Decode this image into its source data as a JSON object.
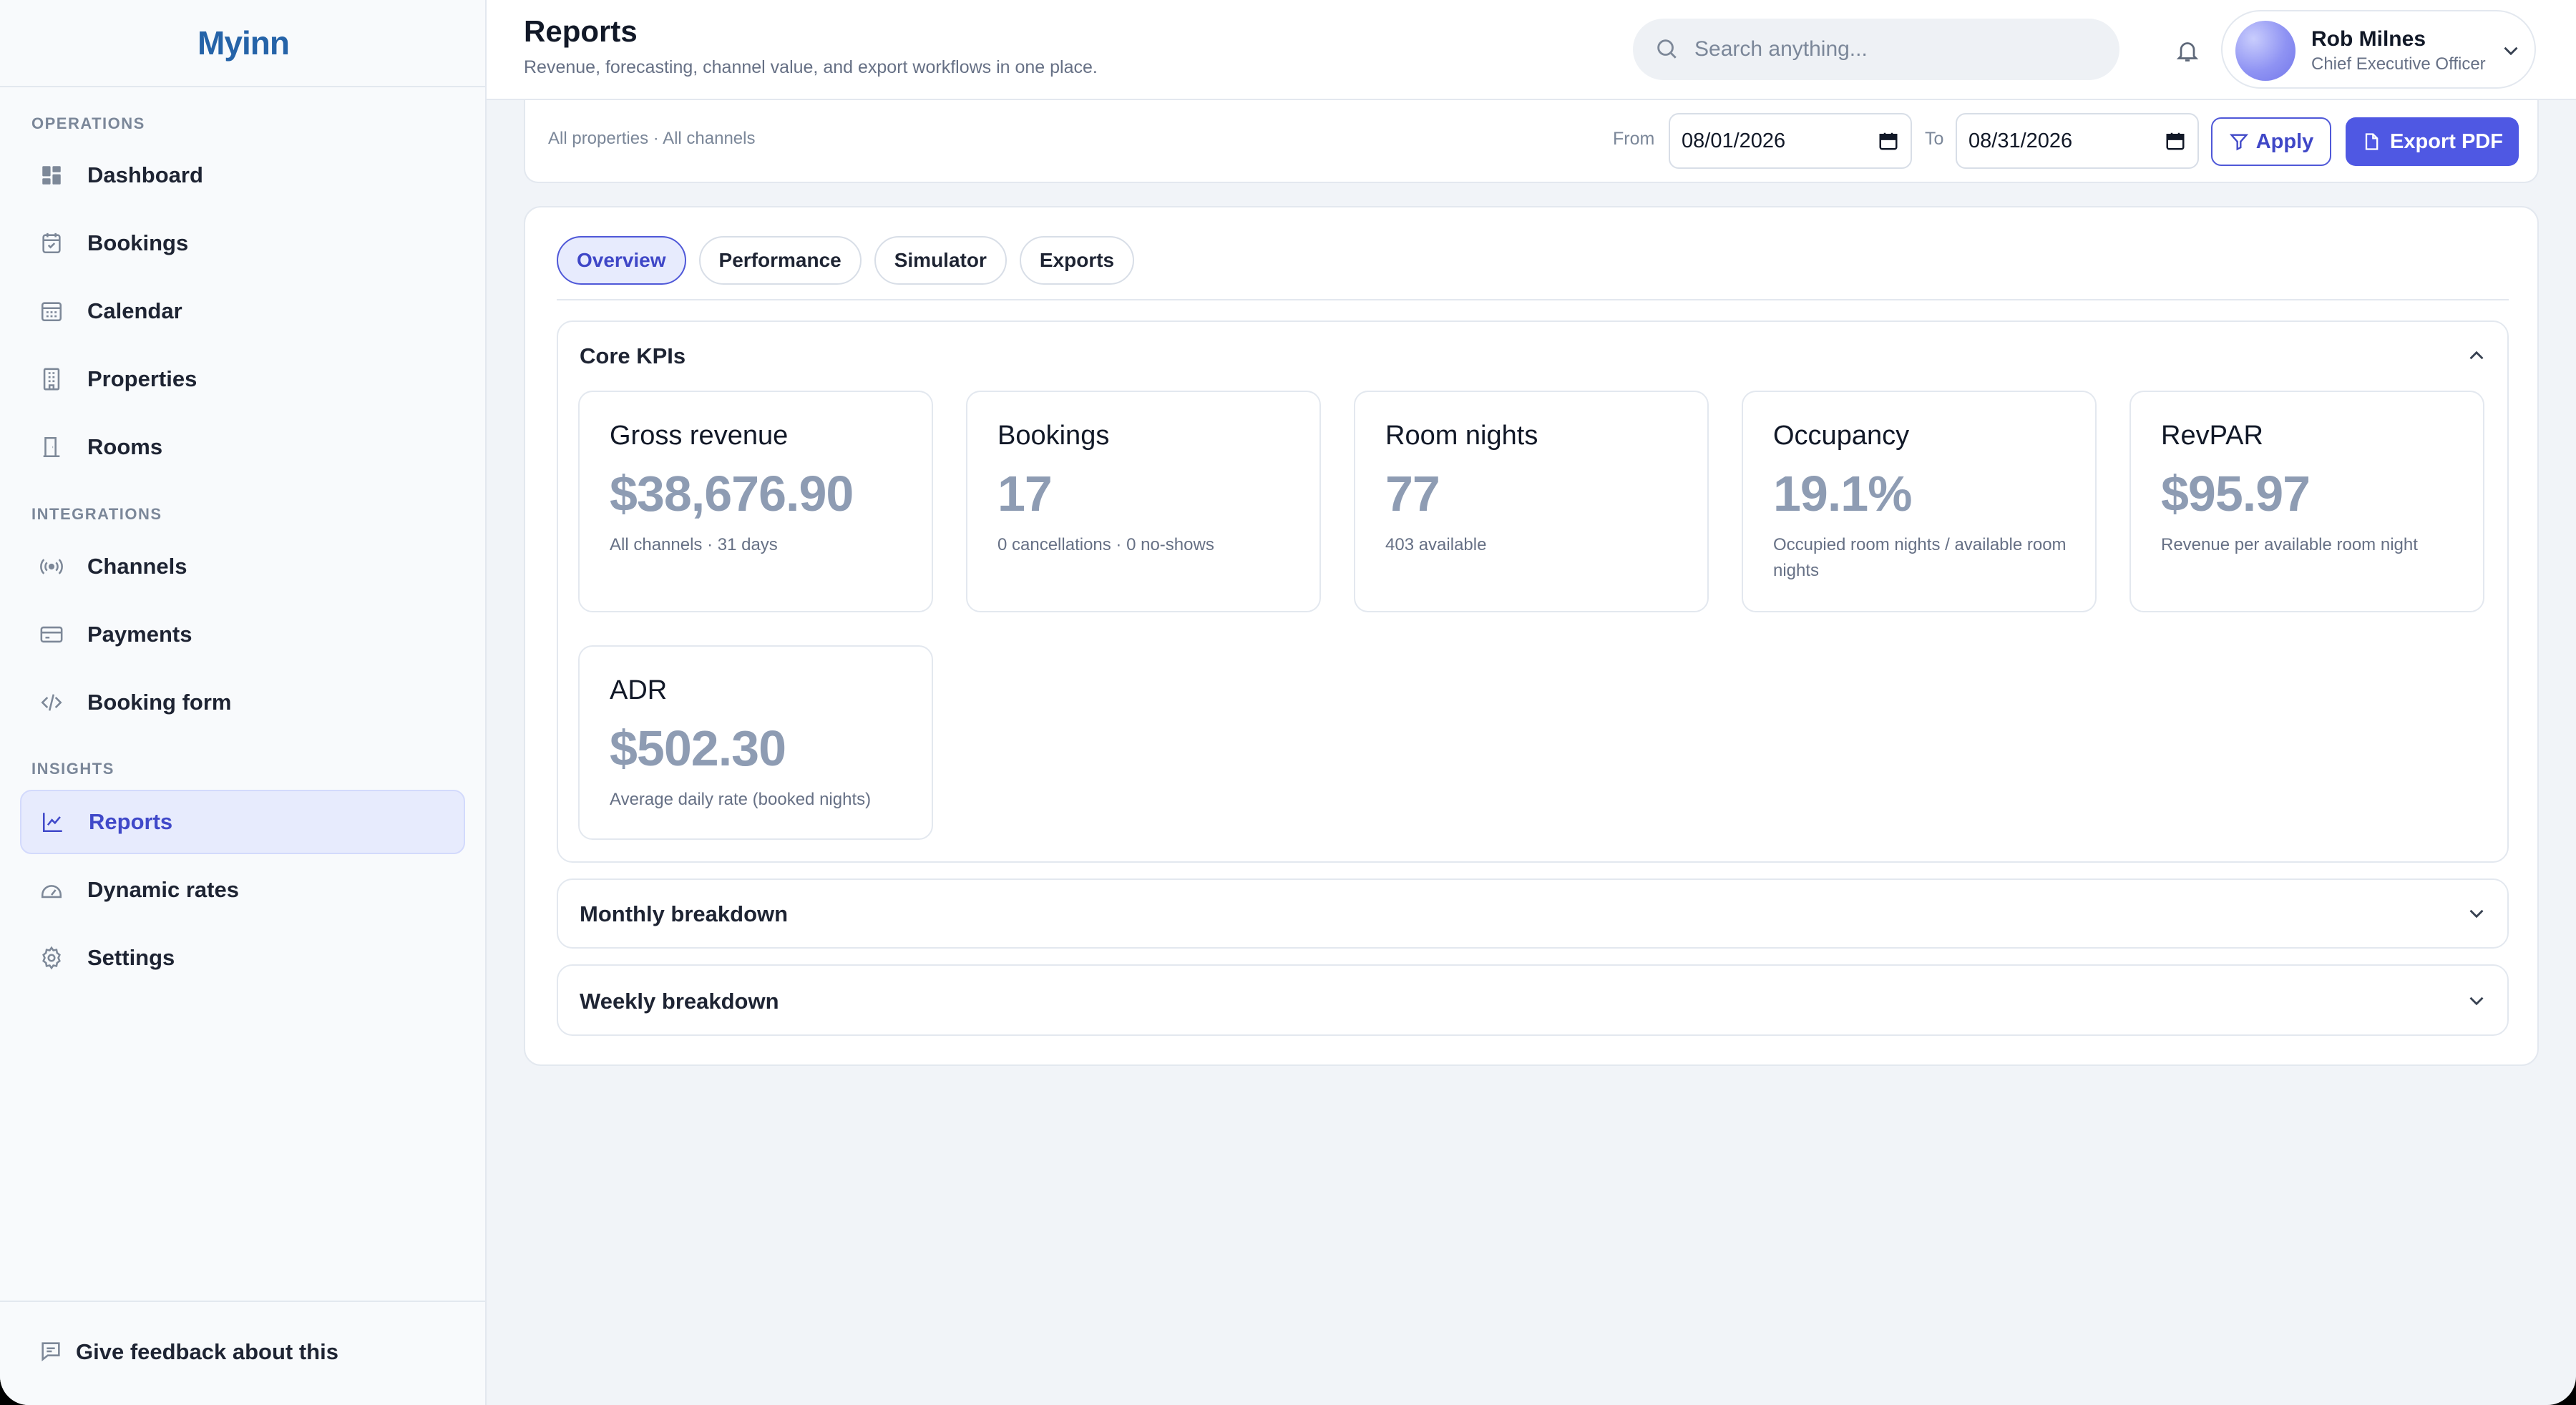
{
  "app": {
    "logo_text": "Myinn"
  },
  "sidebar": {
    "sections": {
      "operations": "OPERATIONS",
      "integrations": "INTEGRATIONS",
      "insights": "INSIGHTS"
    },
    "items": [
      {
        "label": "Dashboard",
        "icon": "dashboard-icon"
      },
      {
        "label": "Bookings",
        "icon": "bookings-icon"
      },
      {
        "label": "Calendar",
        "icon": "calendar-icon"
      },
      {
        "label": "Properties",
        "icon": "building-icon"
      },
      {
        "label": "Rooms",
        "icon": "door-icon"
      },
      {
        "label": "Channels",
        "icon": "broadcast-icon"
      },
      {
        "label": "Payments",
        "icon": "credit-card-icon"
      },
      {
        "label": "Booking form",
        "icon": "code-icon"
      },
      {
        "label": "Reports",
        "icon": "chart-line-icon",
        "active": true
      },
      {
        "label": "Dynamic rates",
        "icon": "gauge-icon"
      },
      {
        "label": "Settings",
        "icon": "gear-icon"
      }
    ],
    "feedback_label": "Give feedback about this"
  },
  "header": {
    "title": "Reports",
    "subtitle": "Revenue, forecasting, channel value, and export workflows in one place.",
    "search_placeholder": "Search anything...",
    "user": {
      "name": "Rob Milnes",
      "role": "Chief Executive Officer"
    }
  },
  "filters": {
    "scope": "All properties · All channels",
    "from_label": "From",
    "from_value": "08/01/2026",
    "to_label": "To",
    "to_value": "08/31/2026",
    "apply_label": "Apply",
    "export_label": "Export PDF"
  },
  "tabs": [
    {
      "label": "Overview",
      "active": true
    },
    {
      "label": "Performance"
    },
    {
      "label": "Simulator"
    },
    {
      "label": "Exports"
    }
  ],
  "core_kpis": {
    "title": "Core KPIs",
    "cards": [
      {
        "label": "Gross revenue",
        "value": "$38,676.90",
        "note": "All channels · 31 days"
      },
      {
        "label": "Bookings",
        "value": "17",
        "note": "0 cancellations · 0 no-shows"
      },
      {
        "label": "Room nights",
        "value": "77",
        "note": "403 available"
      },
      {
        "label": "Occupancy",
        "value": "19.1%",
        "note": "Occupied room nights / available room nights"
      },
      {
        "label": "RevPAR",
        "value": "$95.97",
        "note": "Revenue per available room night"
      },
      {
        "label": "ADR",
        "value": "$502.30",
        "note": "Average daily rate (booked nights)"
      }
    ]
  },
  "monthly": {
    "title": "Monthly breakdown"
  },
  "weekly": {
    "title": "Weekly breakdown"
  },
  "colors": {
    "accent": "#4f58e3",
    "kpi_value": "#8e9cb3",
    "logo": "#2563a8"
  }
}
